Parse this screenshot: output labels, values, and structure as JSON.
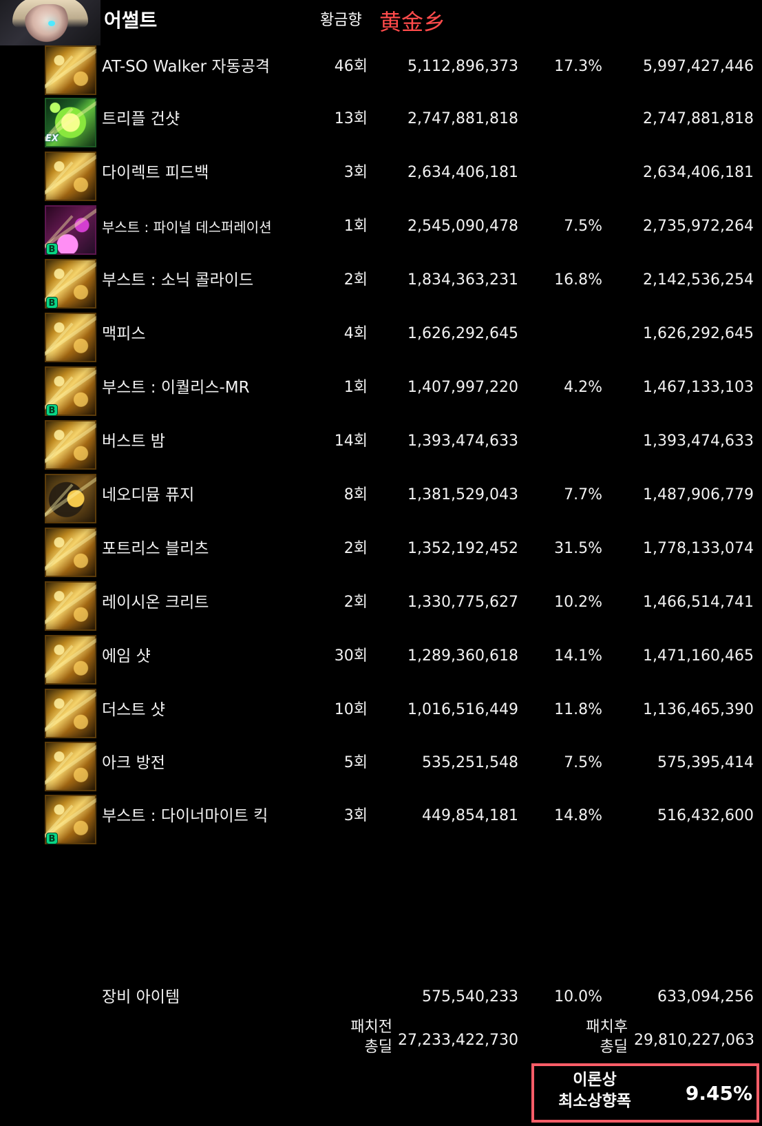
{
  "header": {
    "character": "어썰트",
    "server": "황금향",
    "server_chinese": "黄金乡"
  },
  "skills": [
    {
      "name": "AT-SO Walker 자동공격",
      "count": "46회",
      "damage": "5,112,896,373",
      "boost": "17.3%",
      "after": "5,997,427,446",
      "icon": "walker-icon"
    },
    {
      "name": "트리플 건샷",
      "count": "13회",
      "damage": "2,747,881,818",
      "boost": "",
      "after": "2,747,881,818",
      "icon": "triple-gunshot-icon",
      "badge": "EX"
    },
    {
      "name": "다이렉트 피드백",
      "count": "3회",
      "damage": "2,634,406,181",
      "boost": "",
      "after": "2,634,406,181",
      "icon": "direct-feedback-icon"
    },
    {
      "name": "부스트 : 파이널 데스퍼레이션",
      "count": "1회",
      "damage": "2,545,090,478",
      "boost": "7.5%",
      "after": "2,735,972,264",
      "icon": "final-desperation-icon",
      "badge": "B"
    },
    {
      "name": "부스트 : 소닉 콜라이드",
      "count": "2회",
      "damage": "1,834,363,231",
      "boost": "16.8%",
      "after": "2,142,536,254",
      "icon": "sonic-collide-icon",
      "badge": "B"
    },
    {
      "name": "맥피스",
      "count": "4회",
      "damage": "1,626,292,645",
      "boost": "",
      "after": "1,626,292,645",
      "icon": "maxpeace-icon"
    },
    {
      "name": "부스트 : 이퀄리스-MR",
      "count": "1회",
      "damage": "1,407,997,220",
      "boost": "4.2%",
      "after": "1,467,133,103",
      "icon": "equalis-mr-icon",
      "badge": "B"
    },
    {
      "name": "버스트 밤",
      "count": "14회",
      "damage": "1,393,474,633",
      "boost": "",
      "after": "1,393,474,633",
      "icon": "burst-bomb-icon"
    },
    {
      "name": "네오디뮴 퓨지",
      "count": "8회",
      "damage": "1,381,529,043",
      "boost": "7.7%",
      "after": "1,487,906,779",
      "icon": "neodymium-fuze-icon"
    },
    {
      "name": "포트리스 블리츠",
      "count": "2회",
      "damage": "1,352,192,452",
      "boost": "31.5%",
      "after": "1,778,133,074",
      "icon": "fortress-blitz-icon"
    },
    {
      "name": "레이시온 크리트",
      "count": "2회",
      "damage": "1,330,775,627",
      "boost": "10.2%",
      "after": "1,466,514,741",
      "icon": "raythion-crit-icon"
    },
    {
      "name": "에임 샷",
      "count": "30회",
      "damage": "1,289,360,618",
      "boost": "14.1%",
      "after": "1,471,160,465",
      "icon": "aim-shot-icon"
    },
    {
      "name": "더스트 샷",
      "count": "10회",
      "damage": "1,016,516,449",
      "boost": "11.8%",
      "after": "1,136,465,390",
      "icon": "dust-shot-icon"
    },
    {
      "name": "아크 방전",
      "count": "5회",
      "damage": "535,251,548",
      "boost": "7.5%",
      "after": "575,395,414",
      "icon": "arc-discharge-icon"
    },
    {
      "name": "부스트 : 다이너마이트 킥",
      "count": "3회",
      "damage": "449,854,181",
      "boost": "14.8%",
      "after": "516,432,600",
      "icon": "dynamite-kick-icon",
      "badge": "B"
    }
  ],
  "equipment": {
    "label": "장비 아이템",
    "damage": "575,540,233",
    "boost": "10.0%",
    "after": "633,094,256"
  },
  "totals": {
    "pre_label_1": "패치전",
    "pre_label_2": "총딜",
    "pre_value": "27,233,422,730",
    "post_label_1": "패치후",
    "post_label_2": "총딜",
    "post_value": "29,810,227,063"
  },
  "result": {
    "label_1": "이론상",
    "label_2": "최소상향폭",
    "value": "9.45%",
    "accent": "#ff5d68"
  }
}
